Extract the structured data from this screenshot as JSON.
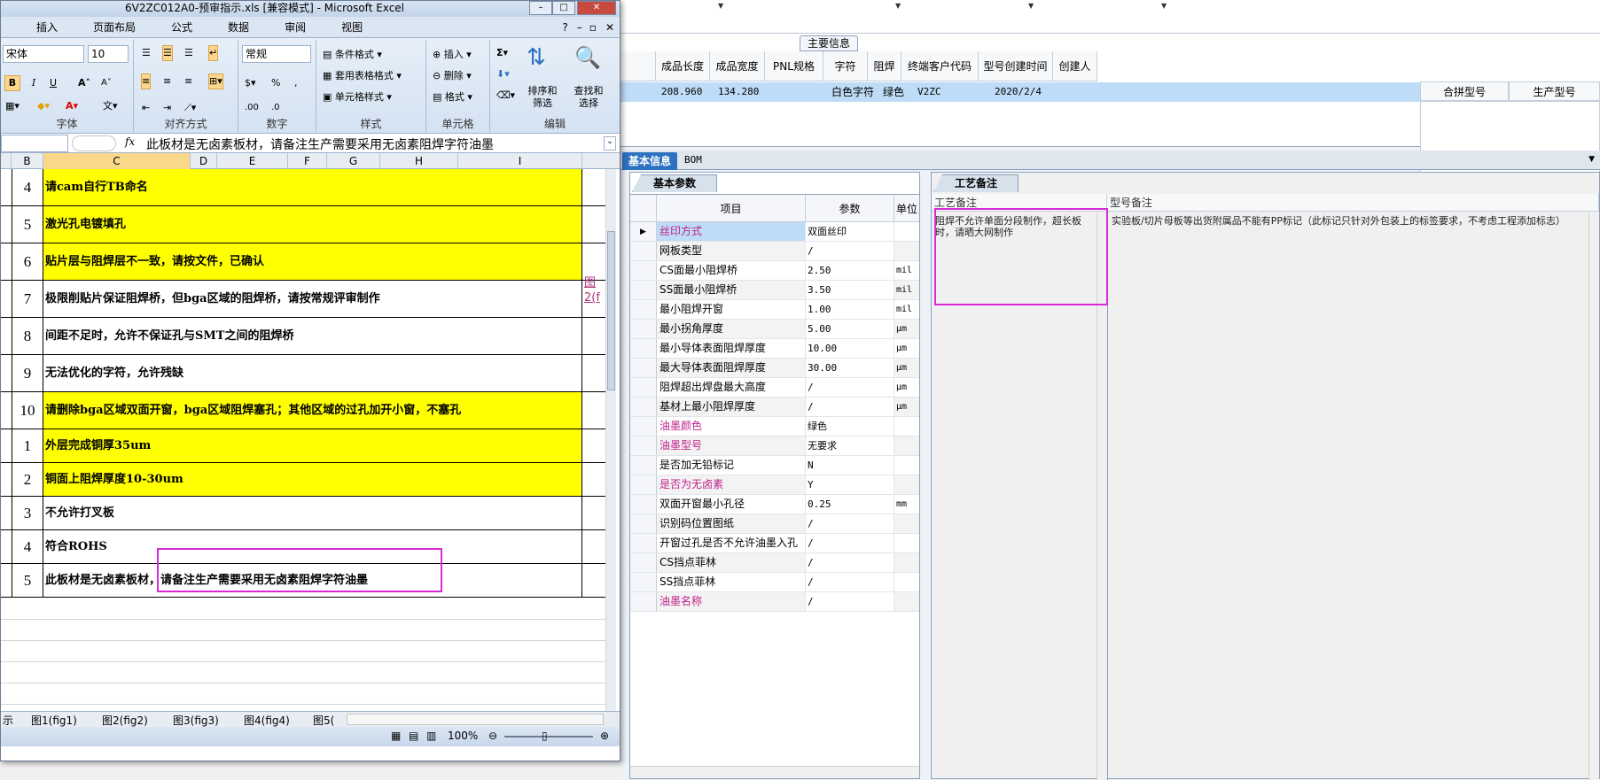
{
  "excel": {
    "title": "6V2ZC012A0-预审指示.xls  [兼容模式] - Microsoft Excel",
    "menu": [
      "插入",
      "页面布局",
      "公式",
      "数据",
      "审阅",
      "视图"
    ],
    "ribbon": {
      "font_name": "宋体",
      "font_size": "10",
      "number_format": "常规",
      "group_font": "字体",
      "group_align": "对齐方式",
      "group_number": "数字",
      "group_style": "样式",
      "group_cells": "单元格",
      "group_edit": "编辑",
      "cond_format": "条件格式",
      "table_format": "套用表格格式",
      "cell_style": "单元格样式",
      "insert": "插入",
      "delete": "删除",
      "format": "格式",
      "sort_filter": "排序和\n筛选",
      "find_select": "查找和\n选择",
      "bold": "B",
      "italic": "I",
      "underline": "U",
      "percent": "%",
      "fx": "fx"
    },
    "formula_text": "此板材是无卤素板材，请备注生产需要采用无卤素阻焊字符油墨",
    "columns": [
      "B",
      "C",
      "D",
      "E",
      "F",
      "G",
      "H",
      "I"
    ],
    "rows": [
      {
        "num": "4",
        "text": "请cam自行TB命名",
        "yellow": true
      },
      {
        "num": "5",
        "text": "激光孔电镀填孔",
        "yellow": true
      },
      {
        "num": "6",
        "text": "贴片层与阻焊层不一致，请按文件，已确认",
        "yellow": true
      },
      {
        "num": "7",
        "text": "极限削贴片保证阻焊桥，但bga区域的阻焊桥，请按常规评审制作",
        "yellow": false
      },
      {
        "num": "8",
        "text": "间距不足时，允许不保证孔与SMT之间的阻焊桥",
        "yellow": false
      },
      {
        "num": "9",
        "text": "无法优化的字符，允许残缺",
        "yellow": false
      },
      {
        "num": "10",
        "text": "请删除bga区域双面开窗，bga区域阻焊塞孔；其他区域的过孔加开小窗，不塞孔",
        "yellow": true
      },
      {
        "num": "1",
        "text": "外层完成铜厚35um",
        "yellow": true
      },
      {
        "num": "2",
        "text": "铜面上阻焊厚度10-30um",
        "yellow": true
      },
      {
        "num": "3",
        "text": "不允许打叉板",
        "yellow": false
      },
      {
        "num": "4",
        "text": "符合ROHS",
        "yellow": false
      },
      {
        "num": "5",
        "text": "此板材是无卤素板材，请备注生产需要采用无卤素阻焊字符油墨",
        "yellow": false
      }
    ],
    "side_link": "图\n2(f",
    "sheet_tabs": [
      "示",
      "图1(fig1)",
      "图2(fig2)",
      "图3(fig3)",
      "图4(fig4)",
      "图5("
    ],
    "zoom": "100%"
  },
  "main": {
    "info_title": "主要信息",
    "headers": [
      "成品长度",
      "成品宽度",
      "PNL规格",
      "字符",
      "阻焊",
      "终端客户代码",
      "型号创建时间",
      "创建人"
    ],
    "row": {
      "length": "208.960",
      "width": "134.280",
      "pnl": "",
      "char": "白色字符",
      "mask": "绿色",
      "customer": "V2ZC",
      "created": "2020/2/4",
      "creator": ""
    },
    "combo_headers": [
      "合拼型号",
      "生产型号"
    ],
    "tabs": {
      "basic": "基本信息",
      "bom": "BOM"
    },
    "params_tab": "基本参数",
    "params_headers": [
      "项目",
      "参数",
      "单位"
    ],
    "params": [
      {
        "item": "丝印方式",
        "val": "双面丝印",
        "unit": "",
        "pink": true
      },
      {
        "item": "网板类型",
        "val": "/",
        "unit": "",
        "pink": false
      },
      {
        "item": "CS面最小阻焊桥",
        "val": "2.50",
        "unit": "mil",
        "pink": false
      },
      {
        "item": "SS面最小阻焊桥",
        "val": "3.50",
        "unit": "mil",
        "pink": false
      },
      {
        "item": "最小阻焊开窗",
        "val": "1.00",
        "unit": "mil",
        "pink": false
      },
      {
        "item": "最小拐角厚度",
        "val": "5.00",
        "unit": "μm",
        "pink": false
      },
      {
        "item": "最小导体表面阻焊厚度",
        "val": "10.00",
        "unit": "μm",
        "pink": false
      },
      {
        "item": "最大导体表面阻焊厚度",
        "val": "30.00",
        "unit": "μm",
        "pink": false
      },
      {
        "item": "阻焊超出焊盘最大高度",
        "val": "/",
        "unit": "μm",
        "pink": false
      },
      {
        "item": "基材上最小阻焊厚度",
        "val": "/",
        "unit": "μm",
        "pink": false
      },
      {
        "item": "油墨颜色",
        "val": "绿色",
        "unit": "",
        "pink": true
      },
      {
        "item": "油墨型号",
        "val": "无要求",
        "unit": "",
        "pink": true
      },
      {
        "item": "是否加无铅标记",
        "val": "N",
        "unit": "",
        "pink": false
      },
      {
        "item": "是否为无卤素",
        "val": "Y",
        "unit": "",
        "pink": true
      },
      {
        "item": "双面开窗最小孔径",
        "val": "0.25",
        "unit": "mm",
        "pink": false
      },
      {
        "item": "识别码位置图纸",
        "val": "/",
        "unit": "",
        "pink": false
      },
      {
        "item": "开窗过孔是否不允许油墨入孔",
        "val": "/",
        "unit": "",
        "pink": false
      },
      {
        "item": "CS挡点菲林",
        "val": "/",
        "unit": "",
        "pink": false
      },
      {
        "item": "SS挡点菲林",
        "val": "/",
        "unit": "",
        "pink": false
      },
      {
        "item": "油墨名称",
        "val": "/",
        "unit": "",
        "pink": true
      }
    ],
    "remarks_tab": "工艺备注",
    "remarks_col1": "工艺备注",
    "remarks_col2": "型号备注",
    "remark1": "阻焊不允许单面分段制作，超长板时，请晒大网制作",
    "remark2": "实验板/切片母板等出货附属品不能有PP标记（此标记只针对外包装上的标签要求，不考虑工程添加标志）"
  }
}
